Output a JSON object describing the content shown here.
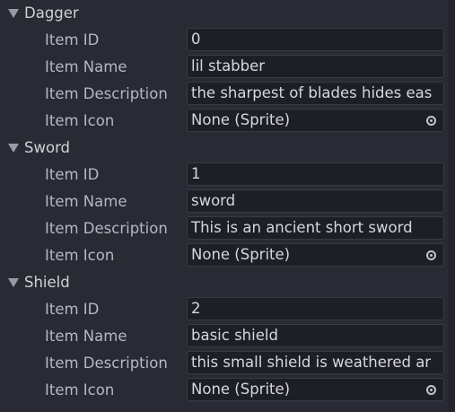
{
  "groups": [
    {
      "title": "Dagger",
      "fields": [
        {
          "label": "Item ID",
          "value": "0"
        },
        {
          "label": "Item Name",
          "value": "lil stabber"
        },
        {
          "label": "Item Description",
          "value": "the sharpest of blades hides eas"
        },
        {
          "label": "Item Icon",
          "value": "None (Sprite)"
        }
      ]
    },
    {
      "title": "Sword",
      "fields": [
        {
          "label": "Item ID",
          "value": "1"
        },
        {
          "label": "Item Name",
          "value": "sword"
        },
        {
          "label": "Item Description",
          "value": "This is an ancient short sword"
        },
        {
          "label": "Item Icon",
          "value": "None (Sprite)"
        }
      ]
    },
    {
      "title": "Shield",
      "fields": [
        {
          "label": "Item ID",
          "value": "2"
        },
        {
          "label": "Item Name",
          "value": "basic shield"
        },
        {
          "label": "Item Description",
          "value": "this small shield is weathered ar"
        },
        {
          "label": "Item Icon",
          "value": "None (Sprite)"
        }
      ]
    }
  ],
  "icons": {
    "foldout": "triangle-down-icon",
    "object_picker": "object-picker-icon"
  }
}
